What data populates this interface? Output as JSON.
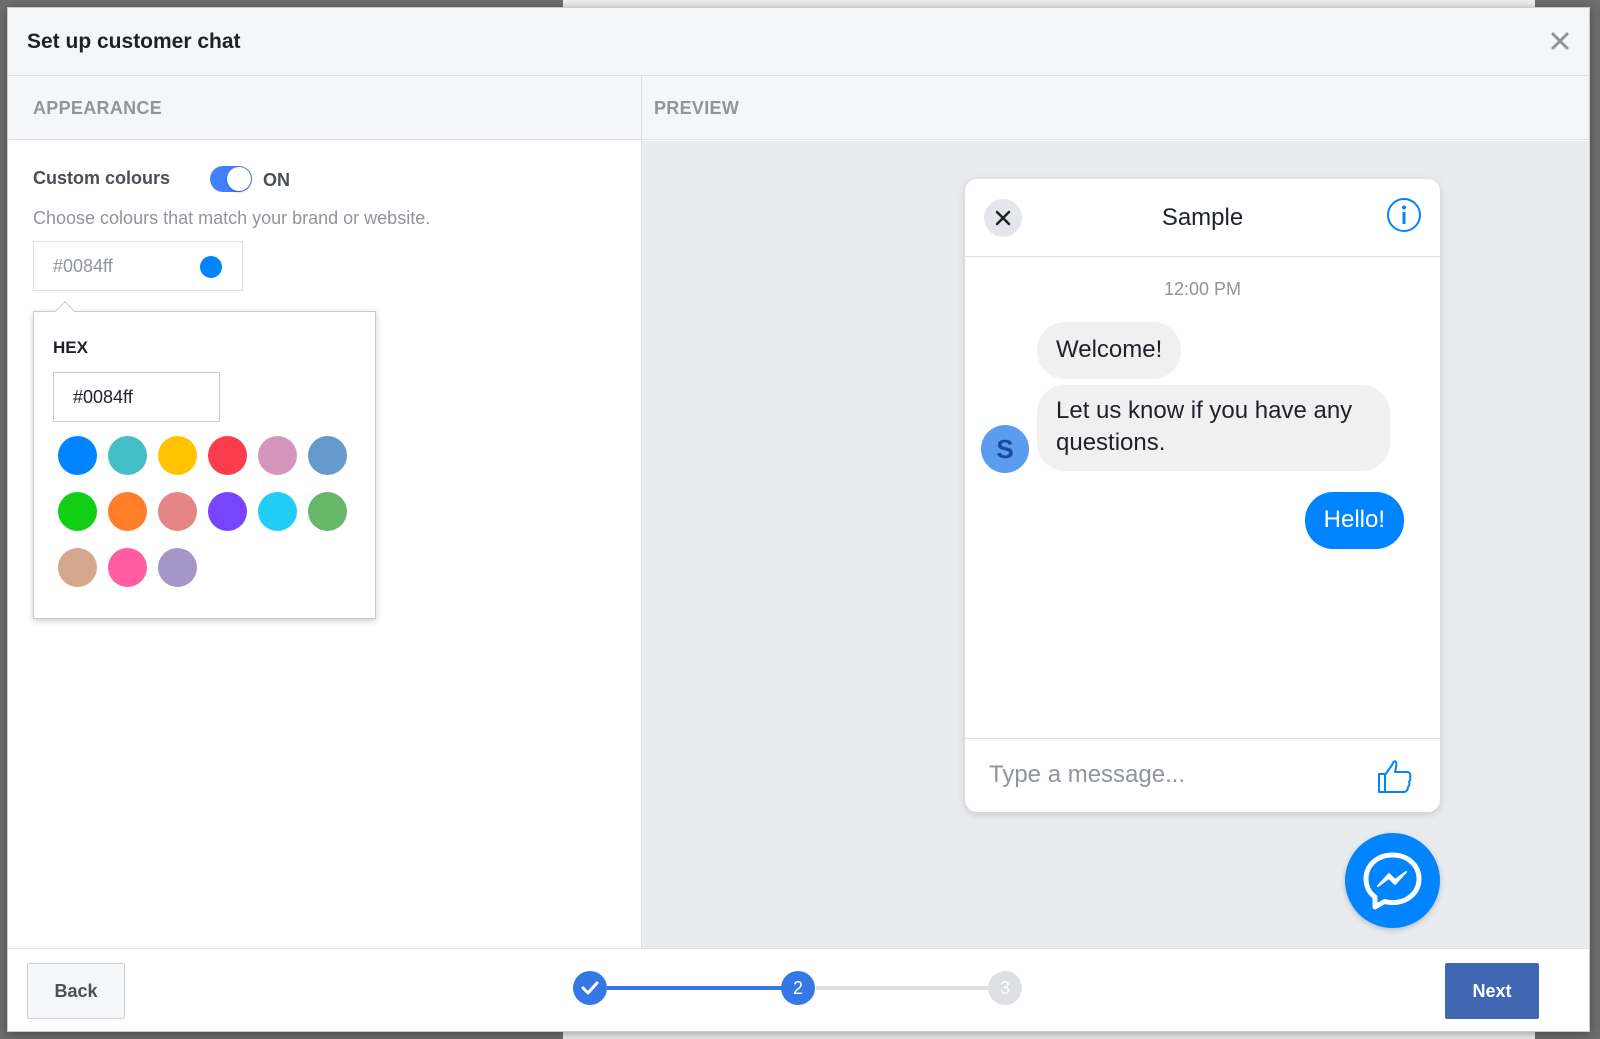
{
  "dialog": {
    "title": "Set up customer chat",
    "close_icon": "close-icon"
  },
  "sections": {
    "appearance": "APPEARANCE",
    "preview": "PREVIEW"
  },
  "appearance": {
    "custom_colours_label": "Custom colours",
    "toggle_state": "ON",
    "toggle_on": true,
    "help_text": "Choose colours that match your brand or website.",
    "color_value": "#0084ff",
    "picker": {
      "hex_label": "HEX",
      "hex_value": "#0084ff",
      "swatches": [
        "#0084ff",
        "#44bec7",
        "#ffc300",
        "#fa3c4c",
        "#d696bb",
        "#6699cc",
        "#13cf13",
        "#ff7e29",
        "#e68585",
        "#7646ff",
        "#20cef5",
        "#67b868",
        "#d4a88c",
        "#ff5ca1",
        "#a695c7"
      ]
    }
  },
  "preview": {
    "chat_title": "Sample",
    "time": "12:00 PM",
    "messages": {
      "welcome": "Welcome!",
      "question": "Let us know if you have any questions.",
      "reply": "Hello!"
    },
    "avatar_initial": "S",
    "compose_placeholder": "Type a message...",
    "icons": [
      "close-icon",
      "info-icon",
      "thumbs-up-icon",
      "messenger-icon"
    ]
  },
  "footer": {
    "back_label": "Back",
    "next_label": "Next",
    "steps": [
      {
        "label": "",
        "state": "done"
      },
      {
        "label": "2",
        "state": "current"
      },
      {
        "label": "3",
        "state": "upcoming"
      }
    ]
  },
  "colors": {
    "accent": "#0084ff",
    "fb_blue": "#4267b2",
    "step_blue": "#3578e5"
  }
}
